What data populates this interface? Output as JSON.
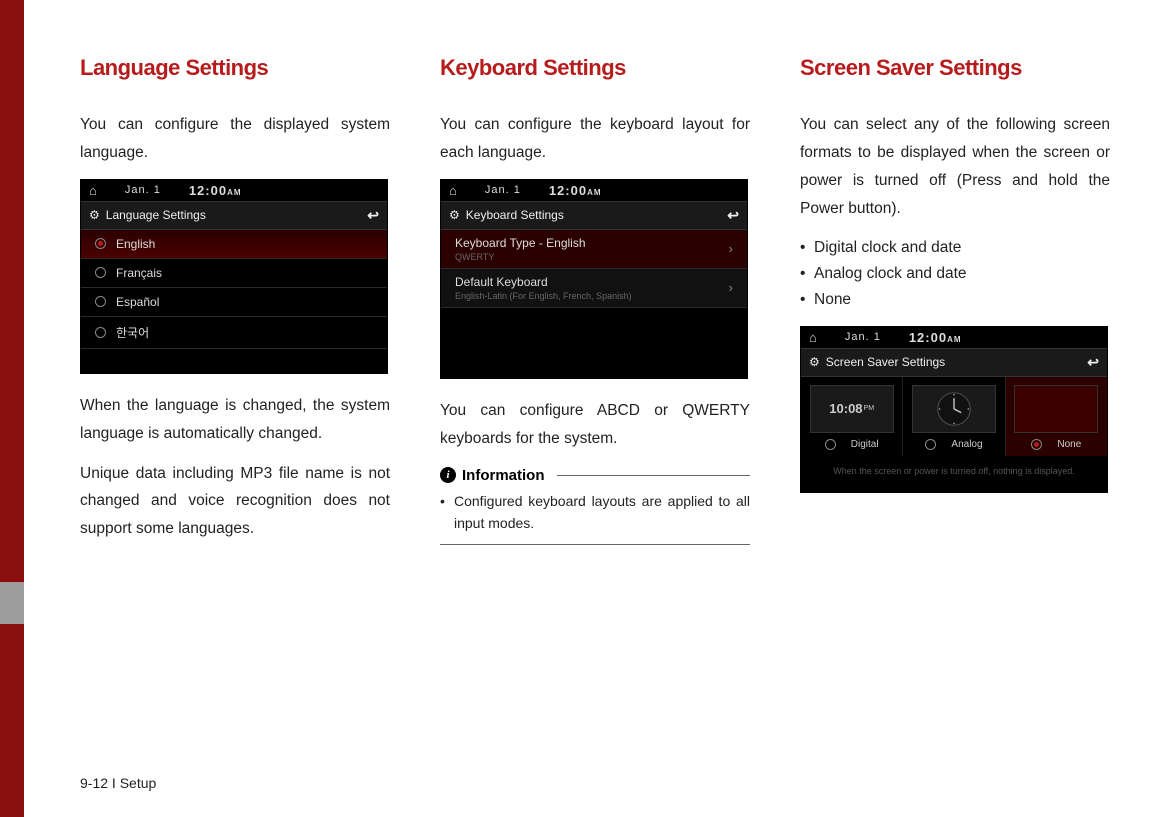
{
  "page_footer": "9-12 I Setup",
  "col1": {
    "heading": "Language Settings",
    "intro": "You can configure the displayed system language.",
    "device": {
      "date": "Jan. 1",
      "time": "12:00",
      "ampm": "AM",
      "title": "Language Settings",
      "options": [
        {
          "label": "English",
          "selected": true
        },
        {
          "label": "Français",
          "selected": false
        },
        {
          "label": "Español",
          "selected": false
        },
        {
          "label": "한국어",
          "selected": false
        }
      ]
    },
    "para1": "When the language is changed, the sys­tem language is automatically changed.",
    "para2": "Unique data including MP3 file name is not changed and voice recognition does not support some languages."
  },
  "col2": {
    "heading": "Keyboard Settings",
    "intro": "You can configure the keyboard layout for each language.",
    "device": {
      "date": "Jan. 1",
      "time": "12:00",
      "ampm": "AM",
      "title": "Keyboard Settings",
      "rows": [
        {
          "main": "Keyboard Type - English",
          "sub": "QWERTY"
        },
        {
          "main": "Default Keyboard",
          "sub": "English-Latin (For English, French, Spanish)"
        }
      ]
    },
    "para1": "You can configure ABCD or QWERTY keyboards for the system.",
    "info_title": "Information",
    "info_text": "Configured keyboard layouts are applied to all input modes."
  },
  "col3": {
    "heading": "Screen Saver Settings",
    "intro": "You can select any of the following screen formats to be displayed when the screen or power is turned off (Press and hold the Power button).",
    "bullets": [
      "Digital clock and date",
      "Analog clock and date",
      "None"
    ],
    "device": {
      "date": "Jan. 1",
      "time": "12:00",
      "ampm": "AM",
      "title": "Screen Saver Settings",
      "digital_preview": "10:08",
      "digital_pm": "PM",
      "option_digital": "Digital",
      "option_analog": "Analog",
      "option_none": "None",
      "selected": "None",
      "caption": "When the screen or power is turned off, nothing is displayed."
    }
  }
}
